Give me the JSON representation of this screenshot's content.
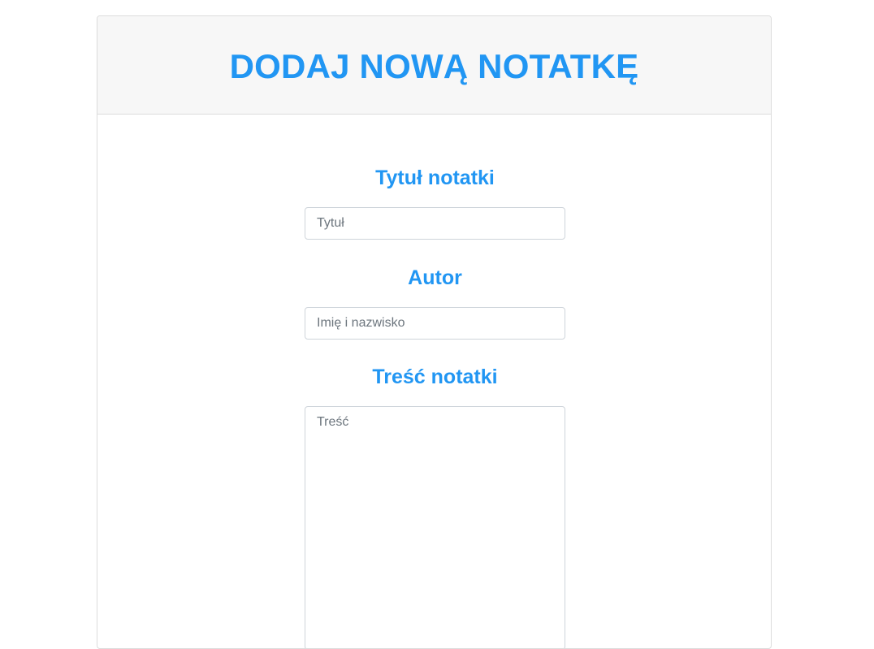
{
  "header": {
    "title": "DODAJ NOWĄ NOTATKĘ"
  },
  "form": {
    "title_field": {
      "label": "Tytuł notatki",
      "placeholder": "Tytuł"
    },
    "author_field": {
      "label": "Autor",
      "placeholder": "Imię i nazwisko"
    },
    "content_field": {
      "label": "Treść notatki",
      "placeholder": "Treść"
    }
  },
  "colors": {
    "accent": "#2196f3",
    "header_bg": "#f7f7f7",
    "border": "#dcdcdc"
  }
}
